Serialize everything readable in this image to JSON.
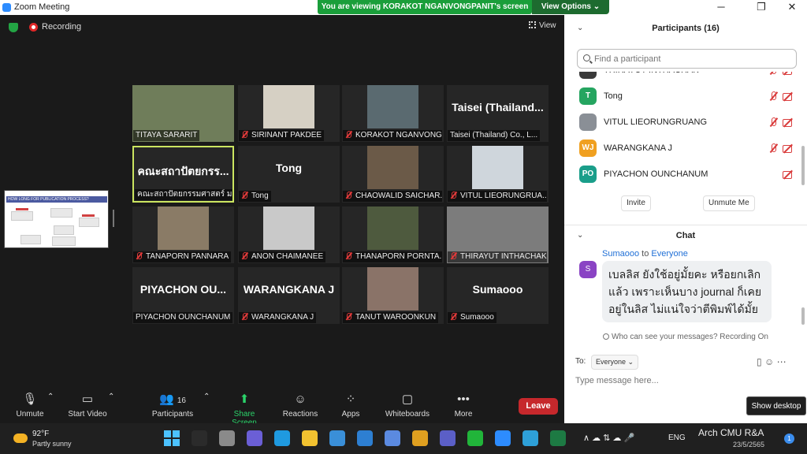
{
  "window": {
    "title": "Zoom Meeting",
    "minimize": "─",
    "maximize": "❐",
    "close": "✕"
  },
  "banner": {
    "text": "You are viewing KORAKOT NGANVONGPANIT's screen",
    "view_options": "View Options ⌄"
  },
  "status": {
    "recording": "Recording",
    "view": "View"
  },
  "share_thumb": {
    "header": "HOW LONG FOR PUBLICATION PROCESS?"
  },
  "tiles": [
    {
      "label": "TITAYA SARARIT",
      "muted": false,
      "big": "",
      "photo": "#6f7d5a"
    },
    {
      "label": "SIRINANT PAKDEE",
      "muted": true,
      "big": "",
      "photo": "#d6d0c4"
    },
    {
      "label": "KORAKOT NGANVONG...",
      "muted": true,
      "big": "",
      "photo": "#5a6a70"
    },
    {
      "label": "Taisei (Thailand) Co., L...",
      "muted": false,
      "big": "Taisei (Thailand...",
      "photo": ""
    },
    {
      "label": "คณะสถาปัตยกรรมศาสตร์ มห...",
      "muted": false,
      "big": "คณะสถาปัตยกรร...",
      "photo": ""
    },
    {
      "label": "Tong",
      "muted": true,
      "big": "Tong",
      "photo": ""
    },
    {
      "label": "CHAOWALID SAICHAR...",
      "muted": true,
      "big": "",
      "photo": "#6b5a48"
    },
    {
      "label": "VITUL LIEORUNGRUA...",
      "muted": true,
      "big": "",
      "photo": "#cfd6dc"
    },
    {
      "label": "TANAPORN PANNARA",
      "muted": true,
      "big": "",
      "photo": "#8a7b66"
    },
    {
      "label": "ANON CHAIMANEE",
      "muted": true,
      "big": "",
      "photo": "#c9c9c9"
    },
    {
      "label": "THANAPORN PORNTA...",
      "muted": true,
      "big": "",
      "photo": "#4e5a3e"
    },
    {
      "label": "THIRAYUT INTHACHAK",
      "muted": true,
      "big": "",
      "photo": "#7c7c7c"
    },
    {
      "label": "PIYACHON OUNCHANUM",
      "muted": false,
      "big": "PIYACHON  OU...",
      "photo": ""
    },
    {
      "label": "WARANGKANA J",
      "muted": true,
      "big": "WARANGKANA J",
      "photo": ""
    },
    {
      "label": "TANUT WAROONKUN",
      "muted": true,
      "big": "",
      "photo": "#8a7368"
    },
    {
      "label": "Sumaooo",
      "muted": true,
      "big": "Sumaooo",
      "photo": ""
    }
  ],
  "toolbar": {
    "unmute": "Unmute",
    "video": "Start Video",
    "participants": "Participants",
    "participants_count": "16",
    "share": "Share Screen",
    "reactions": "Reactions",
    "apps": "Apps",
    "whiteboards": "Whiteboards",
    "more": "More",
    "leave": "Leave"
  },
  "panel": {
    "title": "Participants (16)",
    "search_placeholder": "Find a participant",
    "participants": [
      {
        "initials": "TI",
        "name": "THIRAYUT INTHACHAK",
        "color": "#3a3a3a",
        "mic_muted": true
      },
      {
        "initials": "T",
        "name": "Tong",
        "color": "#25a560",
        "mic_muted": true
      },
      {
        "initials": "",
        "name": "VITUL LIEORUNGRUANG",
        "color": "#8a8f96",
        "mic_muted": true
      },
      {
        "initials": "WJ",
        "name": "WARANGKANA J",
        "color": "#f0a020",
        "mic_muted": true
      },
      {
        "initials": "PO",
        "name": "PIYACHON OUNCHANUM",
        "color": "#1a9e8a",
        "mic_muted": false
      }
    ],
    "invite": "Invite",
    "unmute_me": "Unmute Me",
    "chat_title": "Chat",
    "chat": {
      "sender": "Sumaooo",
      "to_word": "to",
      "recipient": "Everyone",
      "initial": "S",
      "message": "เบลลิส ยังใช้อยู่มั้ยคะ หรือยกเลิกแล้ว เพราะเห็นบาง journal ก็เคยอยู่ในลิส ไม่แน่ใจว่าตีพิมพ์ได้มั้ย"
    },
    "visibility": "Who can see your messages? Recording On",
    "to_label": "To:",
    "to_value": "Everyone ⌄",
    "input_placeholder": "Type message here..."
  },
  "show_desktop": "Show desktop",
  "taskbar": {
    "temp": "92°F",
    "weather": "Partly sunny",
    "tray": "∧  ☁  ⇅  ☁  🎤",
    "lang": "ENG",
    "time": "Arch CMU R&A",
    "date": "23/5/2565",
    "notifications": "1"
  }
}
